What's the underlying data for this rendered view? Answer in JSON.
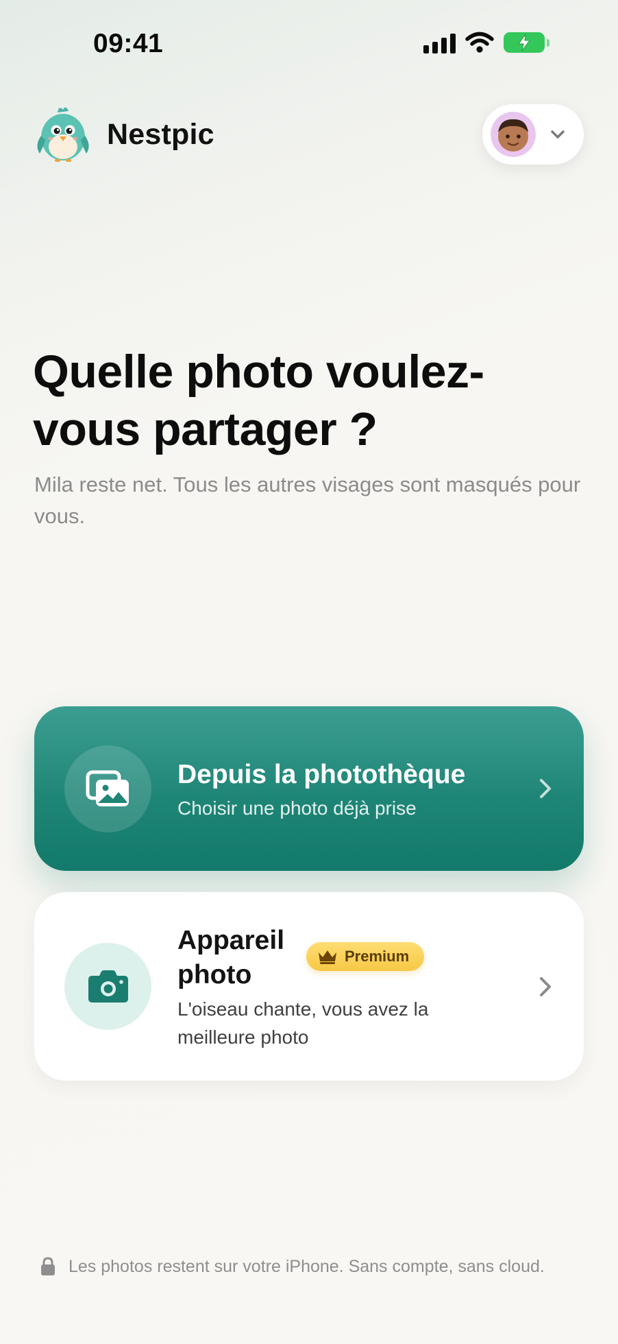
{
  "status_bar": {
    "time": "09:41",
    "icons": [
      "signal-icon",
      "wifi-icon",
      "battery-charging-icon"
    ]
  },
  "header": {
    "brand": "Nestpic",
    "logo_icon": "bird-mascot-icon",
    "profile_menu_icon": "chevron-down-icon"
  },
  "main": {
    "title": "Quelle photo voulez-vous partager ?",
    "subtitle": "Mila reste net. Tous les autres visages sont masqués pour vous."
  },
  "options": {
    "library": {
      "title": "Depuis la photothèque",
      "description": "Choisir une photo déjà prise",
      "icon": "photo-library-icon"
    },
    "camera": {
      "title": "Appareil photo",
      "badge": "Premium",
      "badge_icon": "crown-icon",
      "description": "L'oiseau chante, vous avez la meilleure photo",
      "icon": "camera-icon"
    }
  },
  "footer": {
    "text": "Les photos restent sur votre iPhone. Sans compte, sans cloud.",
    "icon": "lock-icon"
  },
  "colors": {
    "accent_teal": "#1f8677",
    "premium_gold": "#f7c845",
    "mint": "#ddf1ec",
    "battery_green": "#34c759"
  }
}
